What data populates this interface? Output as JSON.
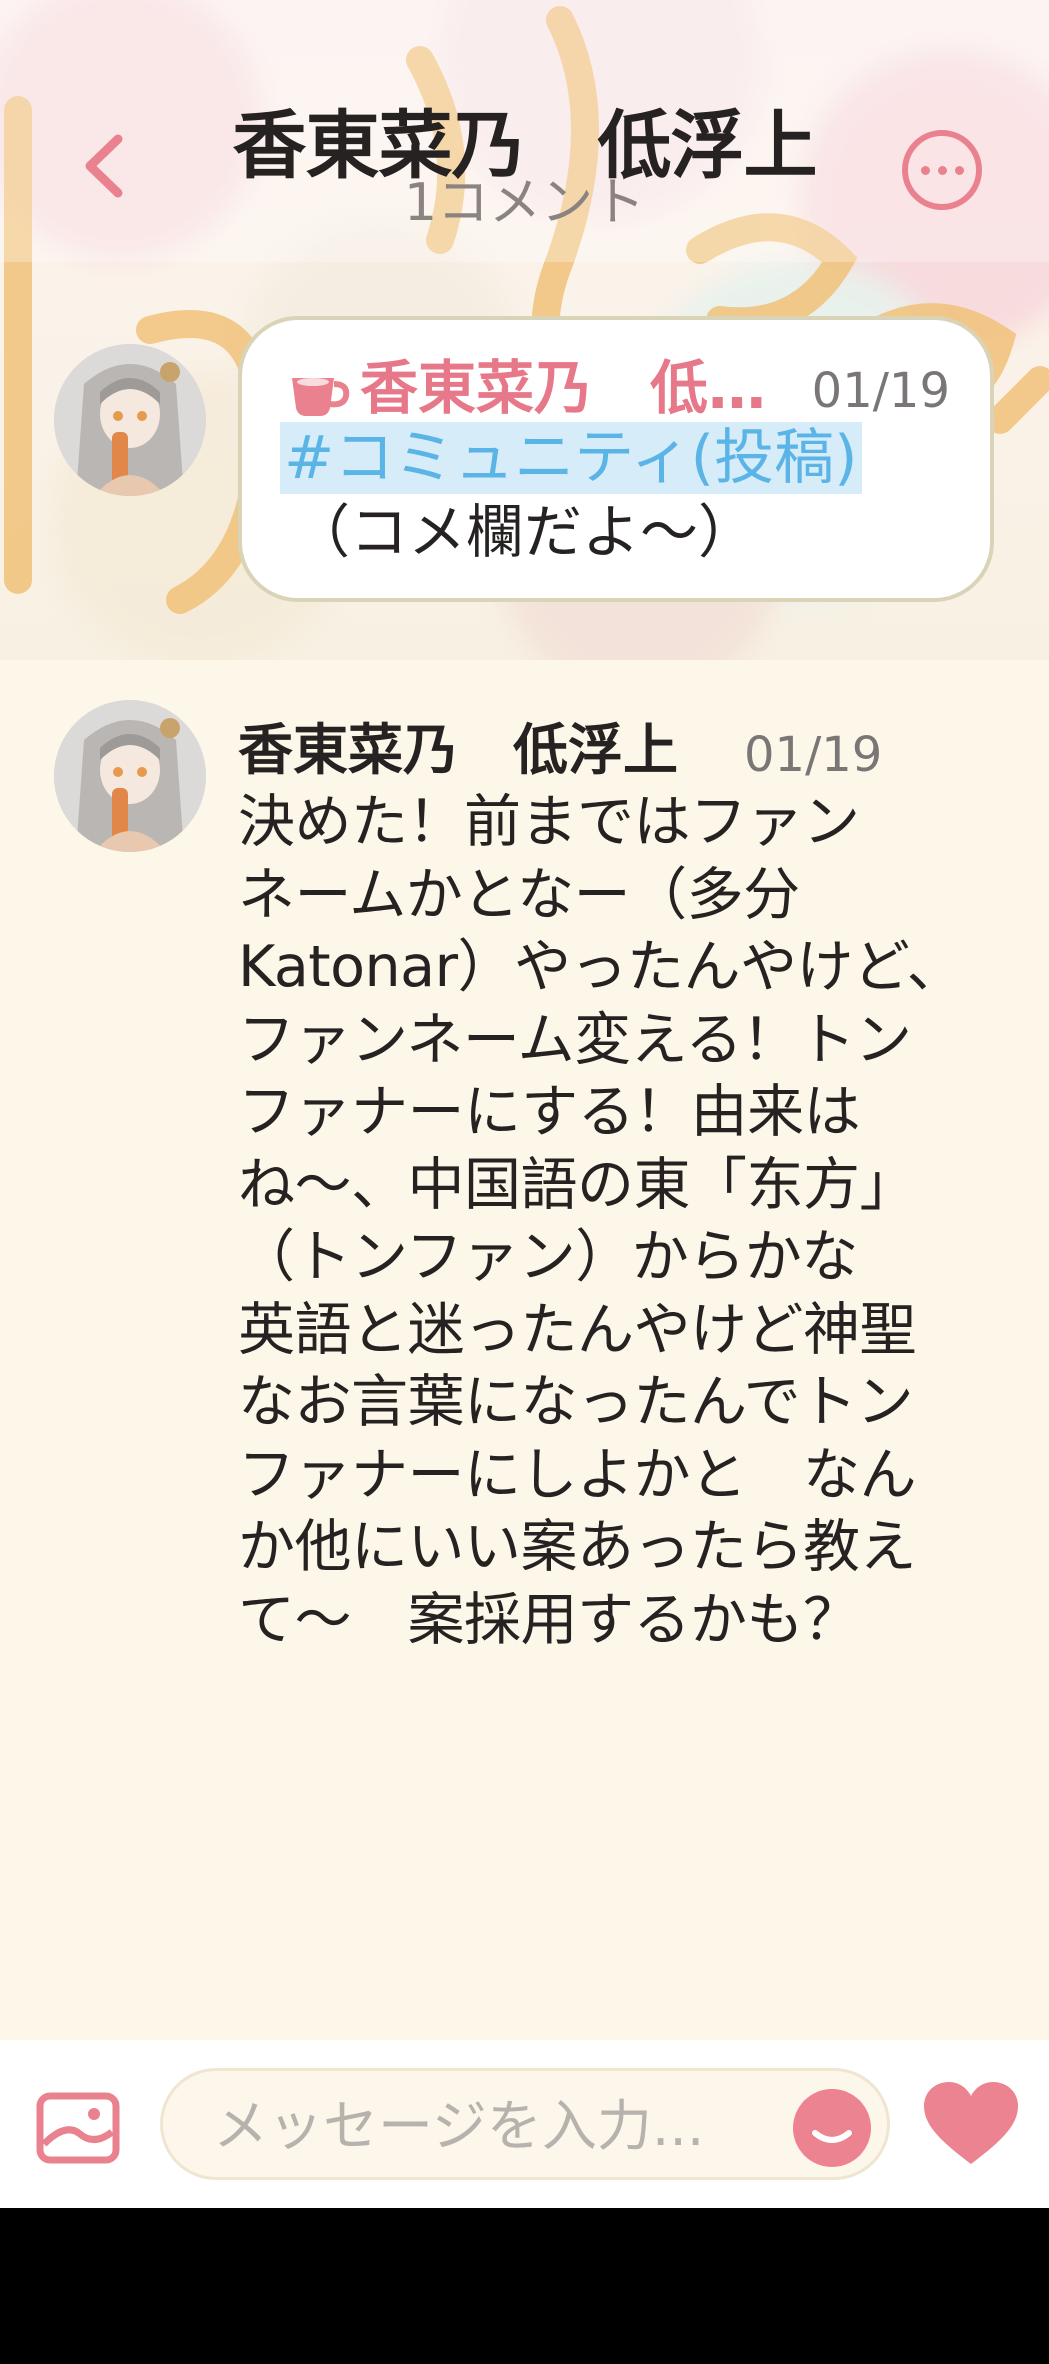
{
  "header": {
    "title": "香東菜乃　低浮上",
    "subtitle": "1コメント",
    "back_icon": "chevron-left-icon",
    "more_icon": "more-horizontal-icon"
  },
  "original_post": {
    "author": "香東菜乃　低浮上",
    "date": "01/19",
    "tag": "#コミュニティ(投稿)",
    "text": "（コメ欄だよ〜）",
    "type_icon": "cup-icon"
  },
  "comments": [
    {
      "author": "香東菜乃　低浮上",
      "date": "01/19",
      "lines": [
        "決めた！前まではファン",
        "ネームかとなー（多分",
        "Katonar）やったんやけど、",
        "ファンネーム変える！トン",
        "ファナーにする！由来は",
        "ね〜、中国語の東「东方」",
        "（トンファン）からかな",
        "英語と迷ったんやけど神聖",
        "なお言葉になったんでトン",
        "ファナーにしよかと　なん",
        "か他にいい案あったら教え",
        "て〜　案採用するかも？"
      ]
    }
  ],
  "input_bar": {
    "placeholder": "メッセージを入力...",
    "image_icon": "image-icon",
    "emoji_icon": "smile-icon",
    "like_icon": "heart-icon"
  },
  "colors": {
    "accent": "#e9828e",
    "tag_blue": "#5bb4e6",
    "background": "#fdf7ea"
  }
}
